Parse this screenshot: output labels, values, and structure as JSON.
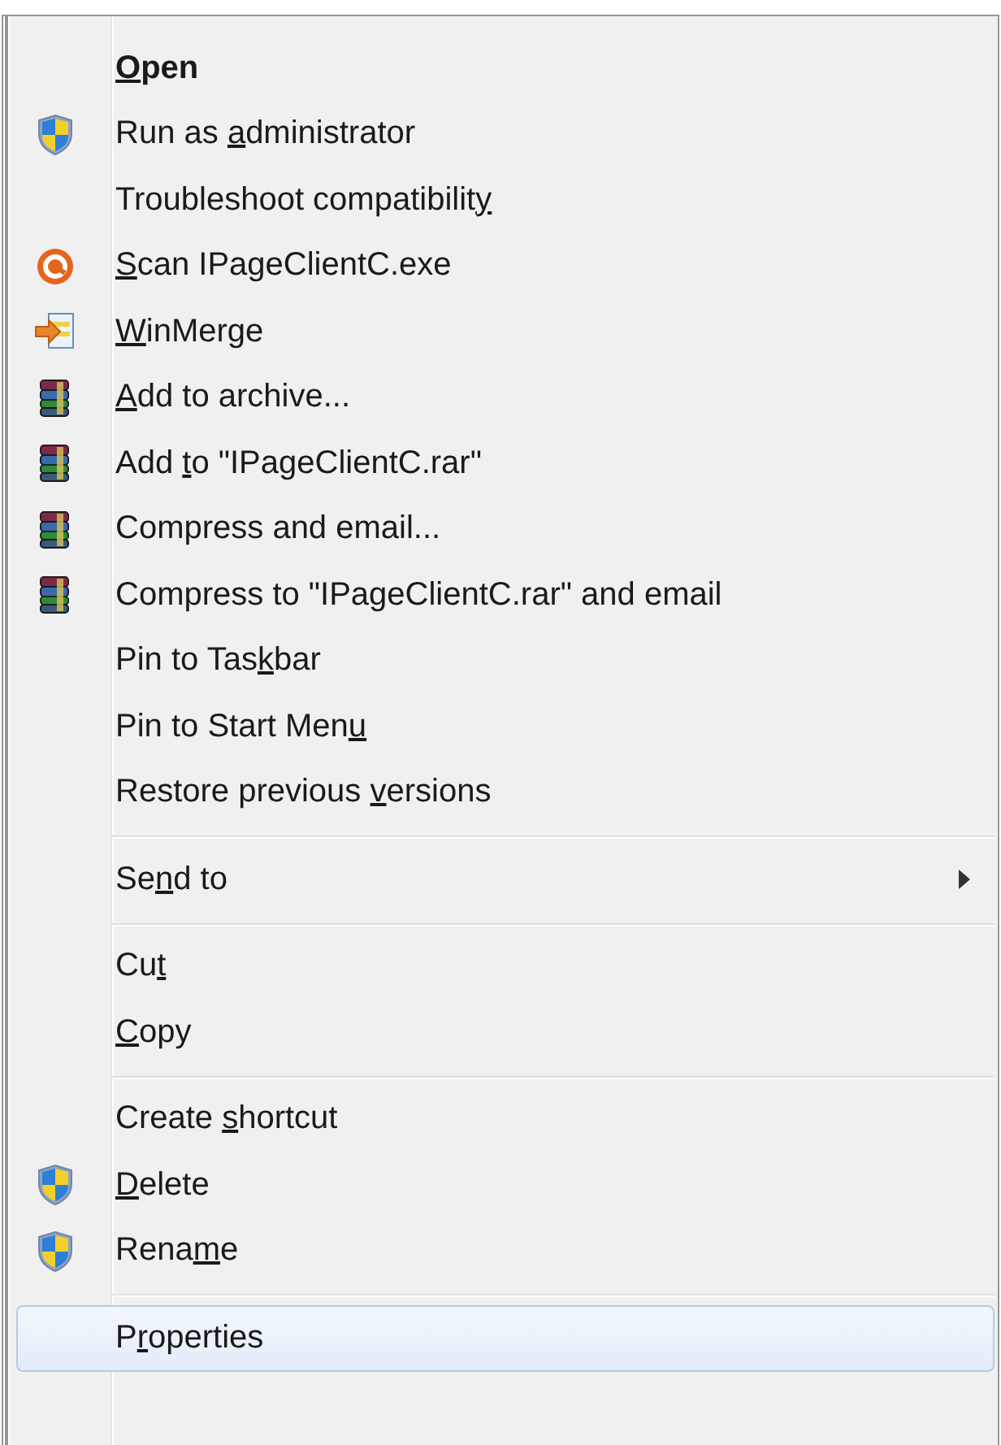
{
  "menu": {
    "items": [
      {
        "kind": "plain",
        "key": "O",
        "after": "pen",
        "default": true,
        "submenu": false,
        "selected": false
      },
      {
        "kind": "shield",
        "before": "Run as ",
        "key": "a",
        "after": "dministrator",
        "default": false,
        "submenu": false,
        "selected": false
      },
      {
        "kind": "plain",
        "before": "Troubleshoot compatibilit",
        "key": "y",
        "default": false,
        "submenu": false,
        "selected": false
      },
      {
        "kind": "scan",
        "key": "S",
        "after": "can IPageClientC.exe",
        "default": false,
        "submenu": false,
        "selected": false
      },
      {
        "kind": "compare",
        "key": "W",
        "after": "inMerge",
        "default": false,
        "submenu": false,
        "selected": false
      },
      {
        "kind": "archive",
        "key": "A",
        "after": "dd to archive...",
        "default": false,
        "submenu": false,
        "selected": false
      },
      {
        "kind": "archive",
        "before": "Add ",
        "key": "t",
        "after": "o \"IPageClientC.rar\"",
        "default": false,
        "submenu": false,
        "selected": false
      },
      {
        "kind": "archive",
        "before": "Compress and email...",
        "default": false,
        "submenu": false,
        "selected": false
      },
      {
        "kind": "archive",
        "before": "Compress to \"IPageClientC.rar\" and email",
        "default": false,
        "submenu": false,
        "selected": false
      },
      {
        "kind": "plain",
        "before": "Pin to Tas",
        "key": "k",
        "after": "bar",
        "default": false,
        "submenu": false,
        "selected": false
      },
      {
        "kind": "plain",
        "before": "Pin to Start Men",
        "key": "u",
        "default": false,
        "submenu": false,
        "selected": false
      },
      {
        "kind": "plain",
        "before": "Restore previous ",
        "key": "v",
        "after": "ersions",
        "default": false,
        "submenu": false,
        "selected": false
      },
      {
        "kind": "separator"
      },
      {
        "kind": "plain",
        "before": "Se",
        "key": "n",
        "after": "d to",
        "default": false,
        "submenu": true,
        "selected": false
      },
      {
        "kind": "separator"
      },
      {
        "kind": "plain",
        "before": "Cu",
        "key": "t",
        "default": false,
        "submenu": false,
        "selected": false
      },
      {
        "kind": "plain",
        "key": "C",
        "after": "opy",
        "default": false,
        "submenu": false,
        "selected": false
      },
      {
        "kind": "separator"
      },
      {
        "kind": "plain",
        "before": "Create ",
        "key": "s",
        "after": "hortcut",
        "default": false,
        "submenu": false,
        "selected": false
      },
      {
        "kind": "shield",
        "key": "D",
        "after": "elete",
        "default": false,
        "submenu": false,
        "selected": false
      },
      {
        "kind": "shield",
        "before": "Rena",
        "key": "m",
        "after": "e",
        "default": false,
        "submenu": false,
        "selected": false
      },
      {
        "kind": "separator"
      },
      {
        "kind": "plain",
        "before": "P",
        "key": "r",
        "after": "operties",
        "default": false,
        "submenu": false,
        "selected": true
      }
    ]
  }
}
